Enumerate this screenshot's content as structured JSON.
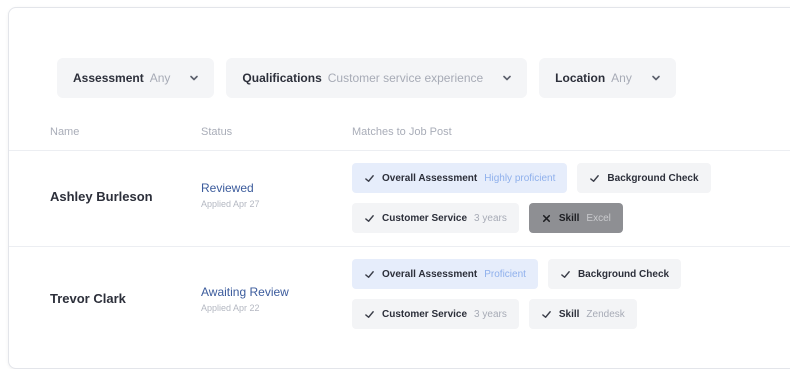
{
  "filters": [
    {
      "label": "Assessment",
      "value": "Any"
    },
    {
      "label": "Qualifications",
      "value": "Customer service experience"
    },
    {
      "label": "Location",
      "value": "Any"
    }
  ],
  "columns": {
    "name": "Name",
    "status": "Status",
    "matches": "Matches to Job Post"
  },
  "candidates": [
    {
      "name": "Ashley Burleson",
      "status": "Reviewed",
      "applied": "Applied Apr 27",
      "matches": [
        {
          "label": "Overall Assessment",
          "value": "Highly proficient",
          "state": "highlight"
        },
        {
          "label": "Background Check",
          "value": "",
          "state": "normal"
        },
        {
          "label": "Customer Service",
          "value": "3 years",
          "state": "normal"
        },
        {
          "label": "Skill",
          "value": "Excel",
          "state": "failed"
        }
      ]
    },
    {
      "name": "Trevor Clark",
      "status": "Awaiting Review",
      "applied": "Applied Apr 22",
      "matches": [
        {
          "label": "Overall Assessment",
          "value": "Proficient",
          "state": "highlight"
        },
        {
          "label": "Background Check",
          "value": "",
          "state": "normal"
        },
        {
          "label": "Customer Service",
          "value": "3 years",
          "state": "normal"
        },
        {
          "label": "Skill",
          "value": "Zendesk",
          "state": "normal"
        }
      ]
    }
  ],
  "icons": {
    "check": "check-icon",
    "cross": "x-icon",
    "chevron": "chevron-down-icon"
  },
  "colors": {
    "status_link": "#3b5b9c",
    "highlight_bg": "#e6edfb",
    "failed_bg": "#8e8f93"
  }
}
